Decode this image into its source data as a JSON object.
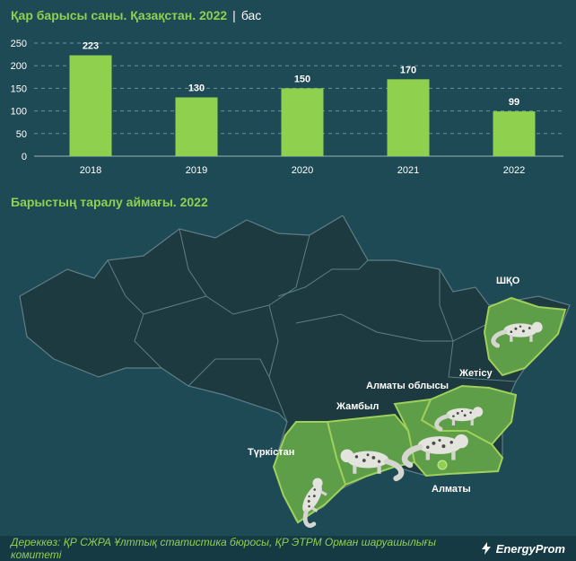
{
  "header": {
    "title": "Қар барысы саны. Қазақстан. 2022",
    "separator": "|",
    "unit": "бас"
  },
  "colors": {
    "background": "#1e4a56",
    "accent": "#8fd14f",
    "bar": "#8fd14f",
    "region": "#1c3a40",
    "highlight": "#5e9e48",
    "border": "#9ed05a"
  },
  "chart_data": {
    "type": "bar",
    "categories": [
      "2018",
      "2019",
      "2020",
      "2021",
      "2022"
    ],
    "values": [
      223,
      130,
      150,
      170,
      99
    ],
    "title": "Қар барысы саны. Қазақстан. 2022",
    "ylabel": "",
    "xlabel": "",
    "ylim": [
      0,
      250
    ],
    "yticks": [
      0,
      50,
      100,
      150,
      200,
      250
    ],
    "grid": true,
    "data_labels": true
  },
  "map_section": {
    "title": "Барыстың таралу аймағы. 2022",
    "labels": {
      "shko": "ШҚО",
      "zhetisu": "Жетісу",
      "almaty_oblysy": "Алматы облысы",
      "zhambyl": "Жамбыл",
      "turkistan": "Түркістан",
      "almaty": "Алматы"
    },
    "icons": [
      "snow-leopard-icon"
    ]
  },
  "footer": {
    "source": "Дереккөз: ҚР СЖРА Ұлттық статистика бюросы, ҚР ЭТРМ Орман шаруашылығы комитеті",
    "brand": "EnergyProm"
  }
}
